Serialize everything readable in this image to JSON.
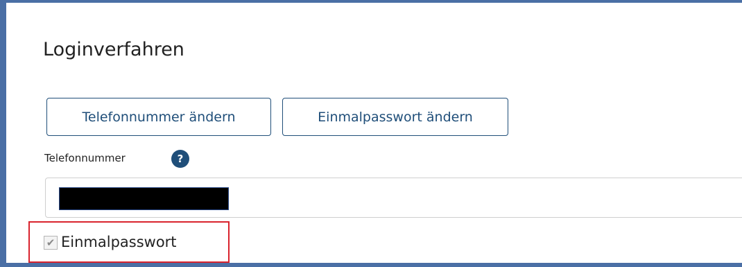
{
  "section": {
    "title": "Loginverfahren"
  },
  "buttons": {
    "change_phone": "Telefonnummer ändern",
    "change_otp": "Einmalpasswort ändern"
  },
  "phone_field": {
    "label": "Telefonnummer",
    "help_icon_glyph": "?",
    "value": "",
    "redacted": true
  },
  "otp_option": {
    "label": "Einmalpasswort",
    "checked": true,
    "disabled": true,
    "check_glyph": "✔"
  },
  "colors": {
    "frame_border": "#4a6fa5",
    "button_text": "#1f4e79",
    "highlight": "#d9232d"
  }
}
